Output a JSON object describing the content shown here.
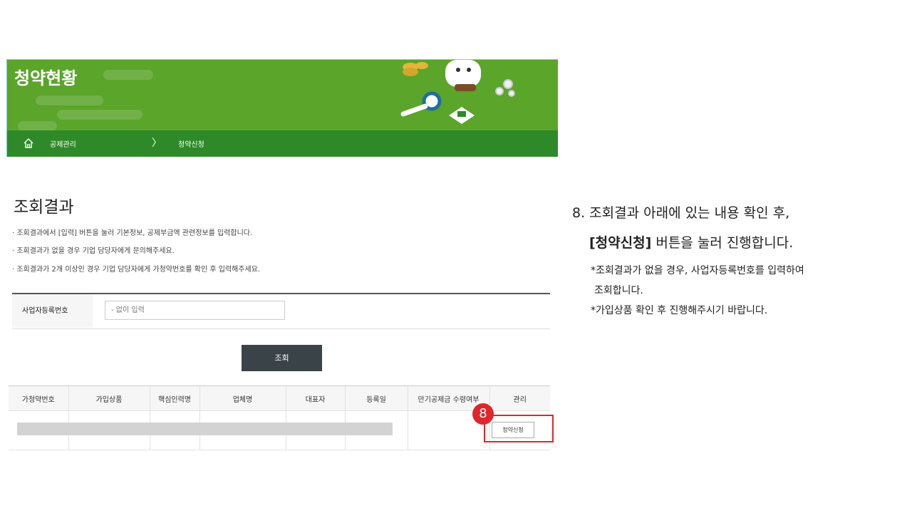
{
  "banner": {
    "title": "청약현황"
  },
  "breadcrumb": {
    "home_icon": "home-icon",
    "item1": "공제관리",
    "separator": "〉",
    "item2": "청약신청"
  },
  "section": {
    "title": "조회결과",
    "notes": [
      "· 조회결과에서 [입력] 버튼을 눌러 기본정보, 공제부금액 관련정보를 입력합니다.",
      "· 조회결과가 없을 경우 기업 담당자에게 문의해주세요.",
      "· 조회결과가 2개 이상인 경우 기업 담당자에게 가청약번호를 확인 후 입력해주세요."
    ]
  },
  "search": {
    "label": "사업자등록번호",
    "placeholder": "- 없이 입력",
    "button_label": "조회"
  },
  "table": {
    "headers": [
      "가청약번호",
      "가입상품",
      "핵심인력명",
      "업체명",
      "대표자",
      "등록일",
      "만기공제금 수령여부",
      "관리"
    ],
    "row_action_label": "청약신청"
  },
  "step_badge": "8",
  "instructions": {
    "line1": "8. 조회결과 아래에 있는 내용 확인 후,",
    "line2_bold": "[청약신청]",
    "line2_rest": " 버튼을 눌러 진행합니다.",
    "sub1": "*조회결과가 없을 경우, 사업자등록번호를 입력하여",
    "sub2": "조회합니다.",
    "sub3": "*가입상품 확인 후 진행해주시기 바랍니다."
  },
  "colors": {
    "banner_green": "#5aa52a",
    "nav_green": "#2e8a28",
    "highlight_red": "#e0262b",
    "search_button": "#3a4348"
  }
}
